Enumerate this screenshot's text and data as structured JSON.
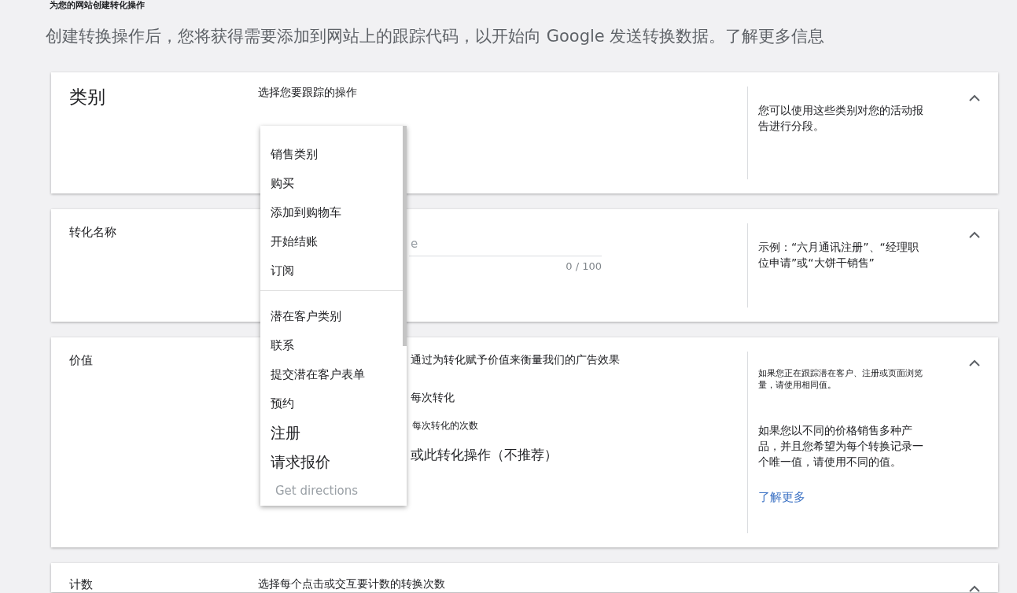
{
  "header": {
    "subtitle": "为您的网站创建转化操作",
    "intro": "创建转换操作后，您将获得需要添加到网站上的跟踪代码，以开始向 Google 发送转换数据。了解更多信息"
  },
  "sections": [
    {
      "kind": "select",
      "label": "类别",
      "expanded": true,
      "body": [
        {
          "kind": "prompt",
          "text": "选择您要跟踪的操作"
        }
      ],
      "help": [
        {
          "kind": "text",
          "text": "您可以使用这些类别对您的活动报告进行分段。"
        }
      ]
    },
    {
      "kind": "text-field",
      "label": "转化名称",
      "expanded": true,
      "field": {
        "placeholder": "e",
        "counter": "0 / 100"
      },
      "help": [
        {
          "kind": "text",
          "text": "示例：“六月通讯注册”、“经理职位申请”或“大饼干销售”"
        }
      ]
    },
    {
      "kind": "value",
      "label": "价值",
      "expanded": true,
      "body": [
        {
          "kind": "prompt",
          "text": "通过为转化赋予价值来衡量我们的广告效果"
        },
        {
          "kind": "prompt",
          "text": "每次转化"
        },
        {
          "kind": "caption",
          "text": "每次转化的次数"
        },
        {
          "kind": "option",
          "text": "或此转化操作（不推荐）"
        }
      ],
      "help": [
        {
          "kind": "small",
          "text": "如果您正在跟踪潜在客户、注册或页面浏览量，请使用相同值。"
        },
        {
          "kind": "text",
          "text": "如果您以不同的价格销售多种产品，并且您希望为每个转换记录一个唯一值，请使用不同的值。"
        },
        {
          "kind": "link",
          "text": "了解更多"
        }
      ]
    },
    {
      "kind": "count",
      "label": "计数",
      "expanded": true,
      "body": [
        {
          "kind": "prompt",
          "text": "选择每个点击或交互要计数的转换次数"
        }
      ]
    }
  ],
  "dropdown": {
    "groups": [
      {
        "items": [
          {
            "kind": "item",
            "label": "销售类别"
          },
          {
            "kind": "item",
            "label": "购买"
          },
          {
            "kind": "item",
            "label": "添加到购物车"
          },
          {
            "kind": "item",
            "label": "开始结账"
          },
          {
            "kind": "item",
            "label": "订阅"
          }
        ]
      },
      {
        "items": [
          {
            "kind": "item",
            "label": "潜在客户类别"
          },
          {
            "kind": "item",
            "label": "联系"
          },
          {
            "kind": "item",
            "label": "提交潜在客户表单"
          },
          {
            "kind": "item",
            "label": "预约"
          },
          {
            "kind": "large",
            "label": "注册"
          },
          {
            "kind": "large",
            "label": "请求报价"
          },
          {
            "kind": "muted",
            "label": "Get directions"
          }
        ]
      }
    ]
  }
}
